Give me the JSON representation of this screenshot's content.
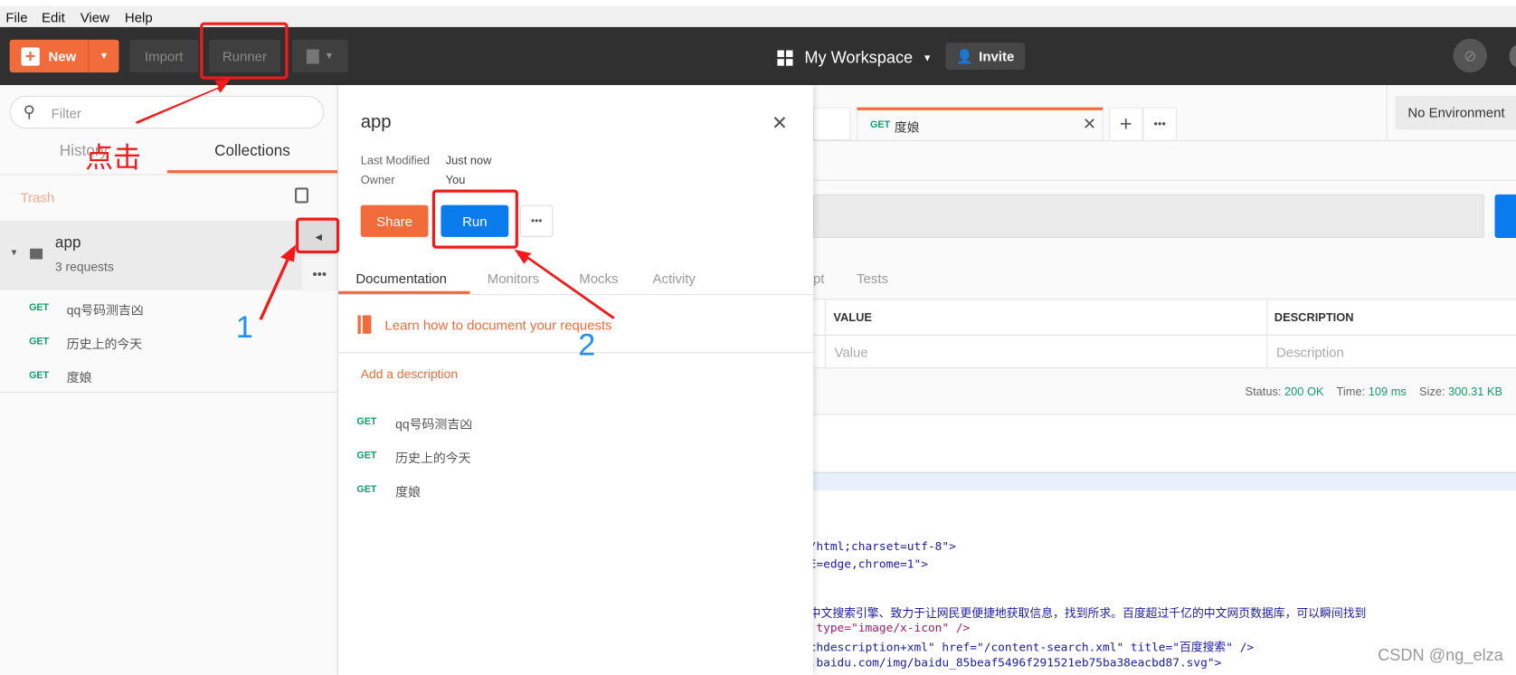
{
  "menu": [
    "File",
    "Edit",
    "View",
    "Help"
  ],
  "toolbar": {
    "new": "New",
    "import": "Import",
    "runner": "Runner",
    "workspace": "My Workspace",
    "invite": "Invite"
  },
  "sidebar": {
    "filter_placeholder": "Filter",
    "tabs": [
      "History",
      "Collections"
    ],
    "trash": "Trash",
    "collection": {
      "name": "app",
      "count": "3 requests"
    },
    "requests": [
      {
        "method": "GET",
        "name": "qq号码测吉凶"
      },
      {
        "method": "GET",
        "name": "历史上的今天"
      },
      {
        "method": "GET",
        "name": "度娘"
      }
    ]
  },
  "panel": {
    "title": "app",
    "last_modified_label": "Last Modified",
    "last_modified": "Just now",
    "owner_label": "Owner",
    "owner": "You",
    "share": "Share",
    "run": "Run",
    "tabs": [
      "Documentation",
      "Monitors",
      "Mocks",
      "Activity"
    ],
    "learn_link": "Learn how to document your requests",
    "add_description": "Add a description",
    "requests": [
      {
        "method": "GET",
        "name": "qq号码测吉凶"
      },
      {
        "method": "GET",
        "name": "历史上的今天"
      },
      {
        "method": "GET",
        "name": "度娘"
      }
    ]
  },
  "main": {
    "tab": {
      "method": "GET",
      "name": "度娘"
    },
    "environment": "No Environment",
    "req_tabs": [
      "pt",
      "Tests"
    ],
    "table": {
      "headers": [
        "VALUE",
        "DESCRIPTION"
      ],
      "placeholders": [
        "Value",
        "Description"
      ]
    },
    "status_label": "Status:",
    "status": "200 OK",
    "time_label": "Time:",
    "time": "109 ms",
    "size_label": "Size:",
    "size": "300.31 KB",
    "code": [
      "/html;charset=utf-8\">",
      "E=edge,chrome=1\">",
      "中文搜索引擎、致力于让网民更便捷地获取信息，找到所求。百度超过千亿的中文网页数据库，可以瞬间找到",
      " type=\"image/x-icon\" />",
      "chdescription+xml\" href=\"/content-search.xml\" title=\"百度搜索\" />",
      ".baidu.com/img/baidu_85beaf5496f291521eb75ba38eacbd87.svg\">"
    ]
  },
  "annotations": {
    "click": "点击",
    "step1": "1",
    "step2": "2"
  },
  "watermark": "CSDN @ng_elza",
  "colors": {
    "accent": "#f26b3a",
    "run": "#097bed",
    "get": "#0fa06a",
    "annotation_red": "#f21a1a",
    "annotation_blue": "#1e90ff"
  }
}
